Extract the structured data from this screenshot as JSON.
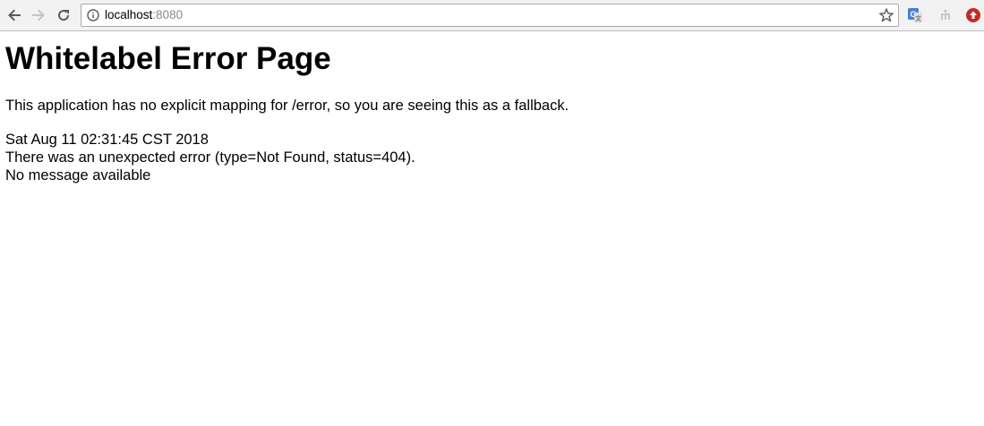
{
  "browser": {
    "url_host": "localhost",
    "url_port": ":8080",
    "icons": {
      "back": "back-arrow-icon",
      "forward": "forward-arrow-icon",
      "reload": "reload-icon",
      "info": "info-icon",
      "bookmark": "star-icon",
      "translate": "google-translate-icon",
      "extension": "extension-icon",
      "adblock": "red-circle-extension-icon"
    }
  },
  "page": {
    "title": "Whitelabel Error Page",
    "description": "This application has no explicit mapping for /error, so you are seeing this as a fallback.",
    "timestamp": "Sat Aug 11 02:31:45 CST 2018",
    "error_line": "There was an unexpected error (type=Not Found, status=404).",
    "message": "No message available"
  },
  "colors": {
    "toolbar_bg": "#f2f2f2",
    "text": "#000000",
    "port_text": "#8a8a8a",
    "translate_blue": "#4a7fd6",
    "extension_red": "#c62828"
  }
}
